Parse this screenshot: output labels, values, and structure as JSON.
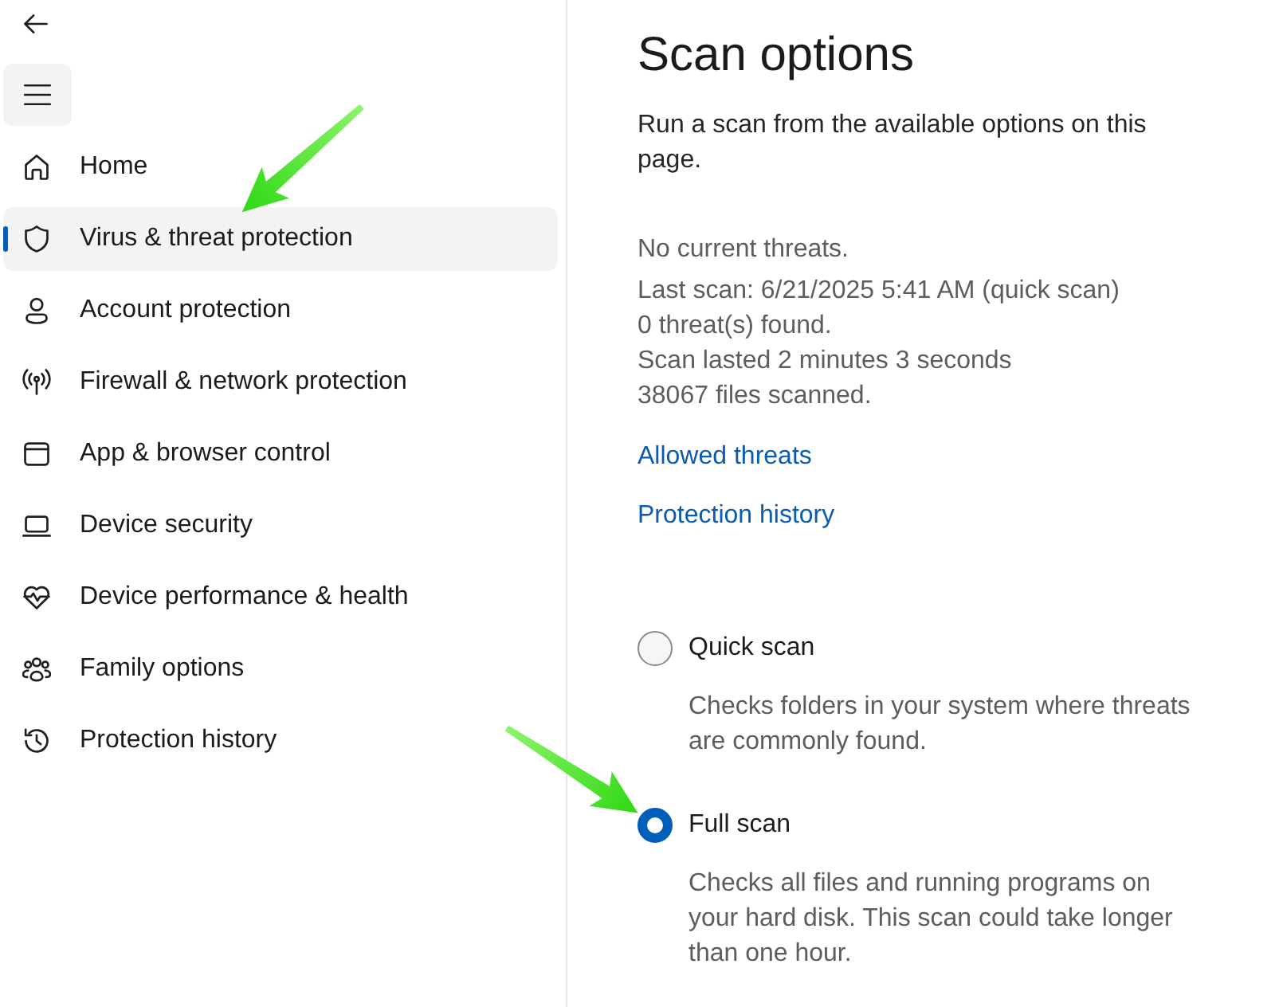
{
  "sidebar": {
    "items": [
      {
        "label": "Home",
        "selected": false
      },
      {
        "label": "Virus & threat protection",
        "selected": true
      },
      {
        "label": "Account protection",
        "selected": false
      },
      {
        "label": "Firewall & network protection",
        "selected": false
      },
      {
        "label": "App & browser control",
        "selected": false
      },
      {
        "label": "Device security",
        "selected": false
      },
      {
        "label": "Device performance & health",
        "selected": false
      },
      {
        "label": "Family options",
        "selected": false
      },
      {
        "label": "Protection history",
        "selected": false
      }
    ]
  },
  "page": {
    "title": "Scan options",
    "intro": "Run a scan from the available options on this page.",
    "status": {
      "summary": "No current threats.",
      "details": [
        "Last scan: 6/21/2025 5:41 AM (quick scan)",
        "0 threat(s) found.",
        "Scan lasted 2 minutes 3 seconds",
        "38067 files scanned."
      ]
    },
    "links": [
      "Allowed threats",
      "Protection history"
    ],
    "scan_options": [
      {
        "label": "Quick scan",
        "description": "Checks folders in your system where threats are commonly found.",
        "selected": false
      },
      {
        "label": "Full scan",
        "description": "Checks all files and running programs on your hard disk. This scan could take longer than one hour.",
        "selected": true
      }
    ]
  }
}
